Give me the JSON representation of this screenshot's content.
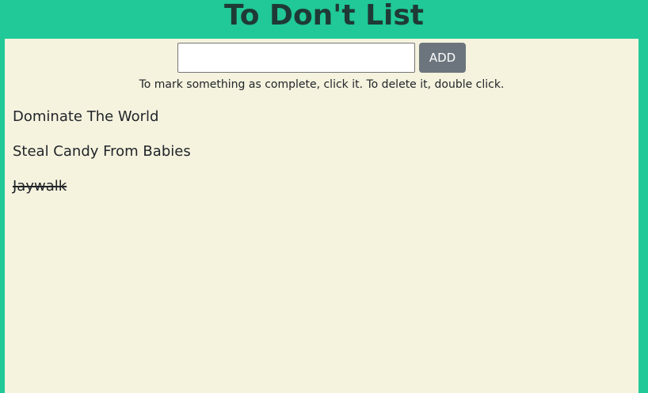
{
  "header": {
    "title": "To Don't List"
  },
  "form": {
    "input_value": "",
    "input_placeholder": "",
    "add_label": "ADD"
  },
  "instructions": "To mark something as complete, click it. To delete it, double click.",
  "todos": [
    {
      "label": "Dominate The World",
      "completed": false
    },
    {
      "label": "Steal Candy From Babies",
      "completed": false
    },
    {
      "label": "Jaywalk",
      "completed": true
    }
  ],
  "colors": {
    "background": "#20c997",
    "panel": "#f5f3de",
    "button": "#6c757d",
    "text": "#212529"
  }
}
